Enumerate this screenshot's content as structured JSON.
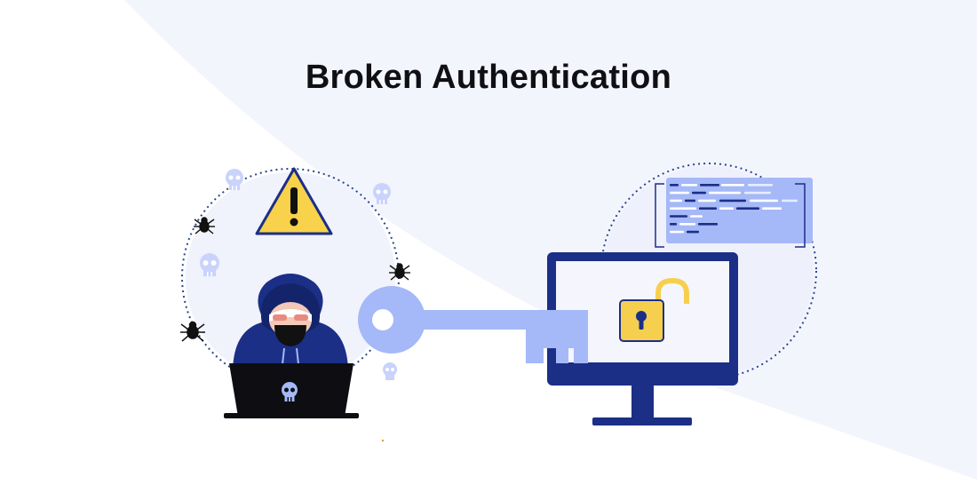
{
  "title": "Broken Authentication",
  "colors": {
    "navy": "#1b2f86",
    "navy_dark": "#14246b",
    "periwinkle": "#a5b8f7",
    "lavender_light": "#c9d3fb",
    "warning_yellow": "#f7d24a",
    "lock_yellow": "#f6cf4f",
    "background_band": "#f3f5fd",
    "text": "#0f0f14"
  },
  "scene": {
    "hacker": {
      "icon": "hooded-hacker-icon",
      "laptop_icon": "skull-icon"
    },
    "warning_icon": "warning-triangle-icon",
    "threat_icons": [
      "skull-icon",
      "skull-icon",
      "skull-icon",
      "skull-icon",
      "spider-bug-icon",
      "spider-bug-icon",
      "spider-bug-icon"
    ],
    "key_icon": "key-icon",
    "monitor": {
      "icon": "monitor-icon",
      "lock_icon": "unlocked-padlock-icon"
    },
    "code_panel_icon": "code-snippet-icon"
  }
}
